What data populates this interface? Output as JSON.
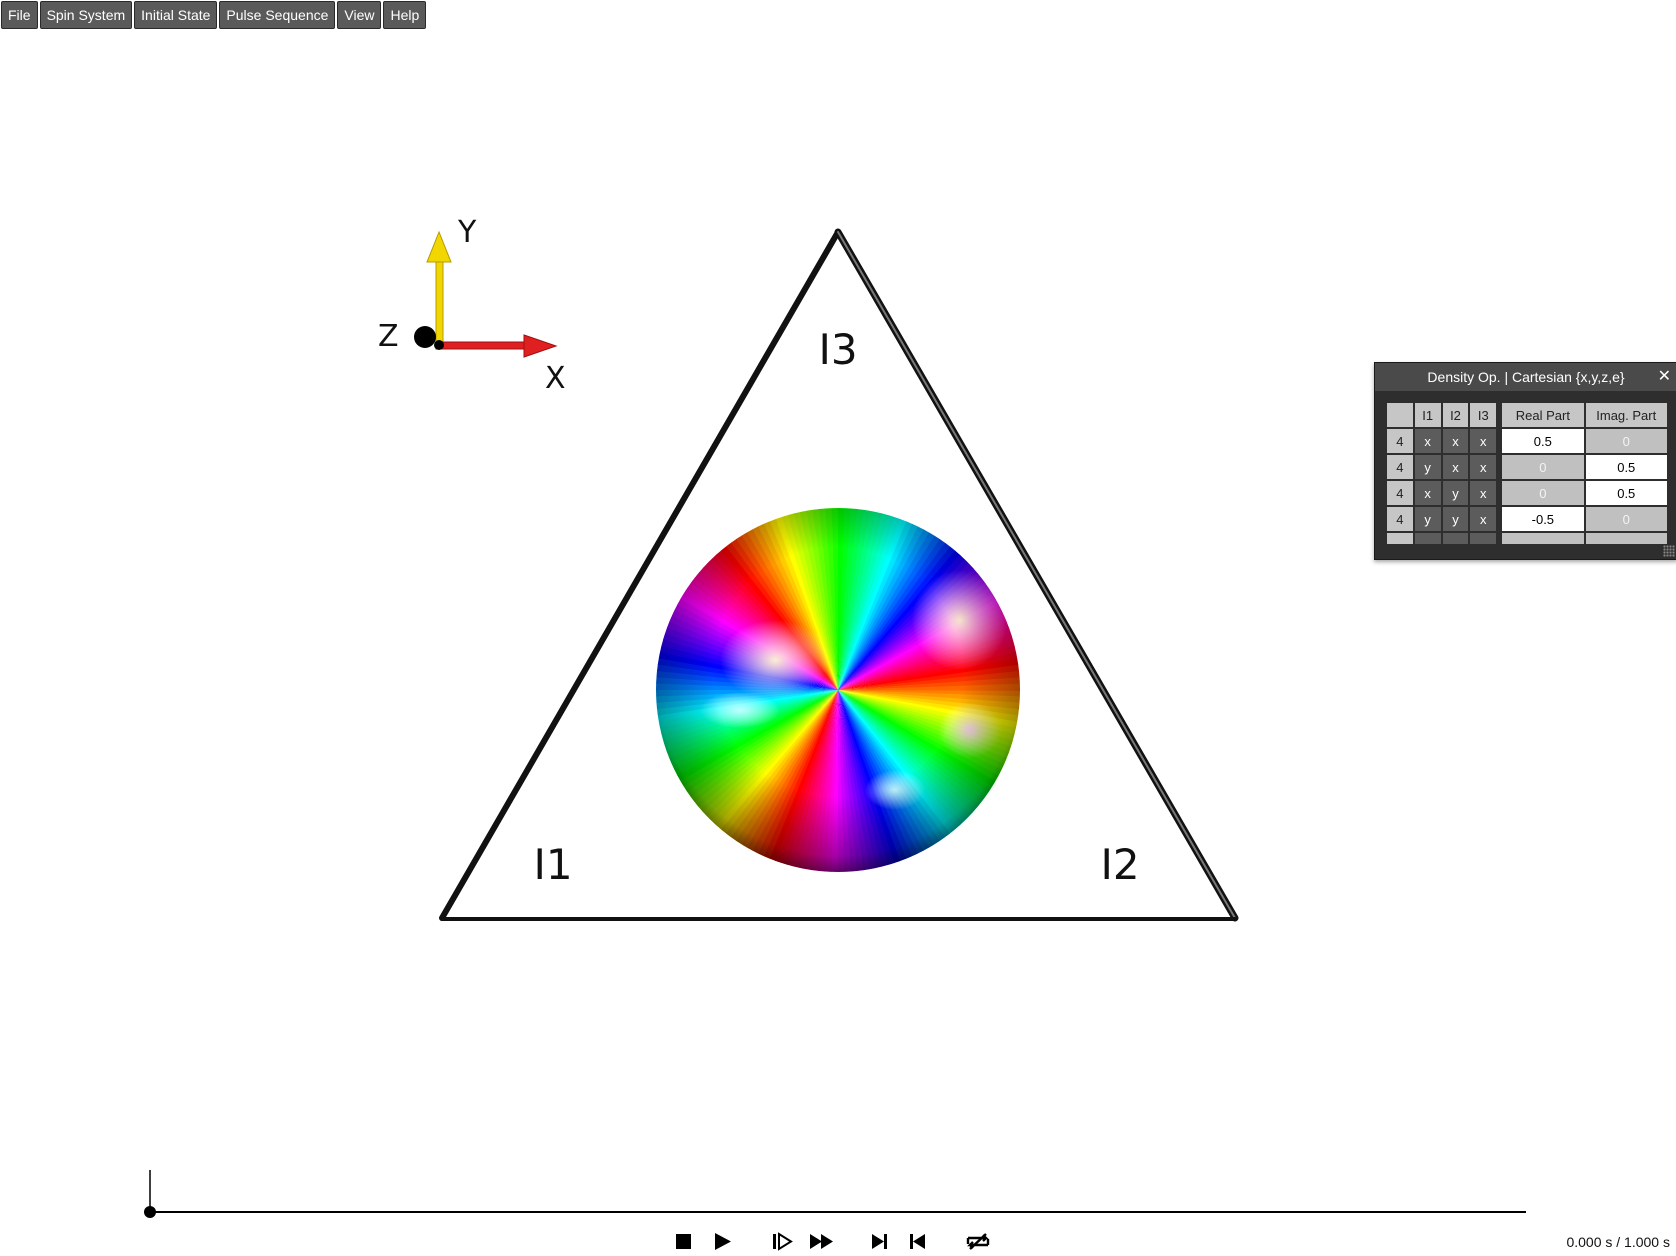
{
  "menu": {
    "items": [
      {
        "label": "File"
      },
      {
        "label": "Spin System"
      },
      {
        "label": "Initial State"
      },
      {
        "label": "Pulse Sequence"
      },
      {
        "label": "View"
      },
      {
        "label": "Help"
      }
    ]
  },
  "axes": {
    "x_label": "X",
    "y_label": "Y",
    "z_label": "Z",
    "x_color": "#e02020",
    "y_color": "#f2d600",
    "z_color": "#000000"
  },
  "spins": {
    "top": "I3",
    "left": "I1",
    "right": "I2"
  },
  "density_panel": {
    "title": "Density Op. | Cartesian {x,y,z,e}",
    "close_icon": "close-icon",
    "columns": [
      "",
      "I1",
      "I2",
      "I3",
      "Real Part",
      "Imag. Part"
    ],
    "rows": [
      {
        "index": "4",
        "ops": [
          "x",
          "x",
          "x"
        ],
        "real": "0.5",
        "imag": "0"
      },
      {
        "index": "4",
        "ops": [
          "y",
          "x",
          "x"
        ],
        "real": "0",
        "imag": "0.5"
      },
      {
        "index": "4",
        "ops": [
          "x",
          "y",
          "x"
        ],
        "real": "0",
        "imag": "0.5"
      },
      {
        "index": "4",
        "ops": [
          "y",
          "y",
          "x"
        ],
        "real": "-0.5",
        "imag": "0"
      }
    ]
  },
  "playback": {
    "progress": 0.0,
    "time": "0.000 s / 1.000 s",
    "controls": [
      "stop-icon",
      "play-icon",
      "step-forward-icon",
      "fast-forward-icon",
      "skip-to-end-icon",
      "skip-to-start-icon",
      "loop-icon"
    ]
  }
}
